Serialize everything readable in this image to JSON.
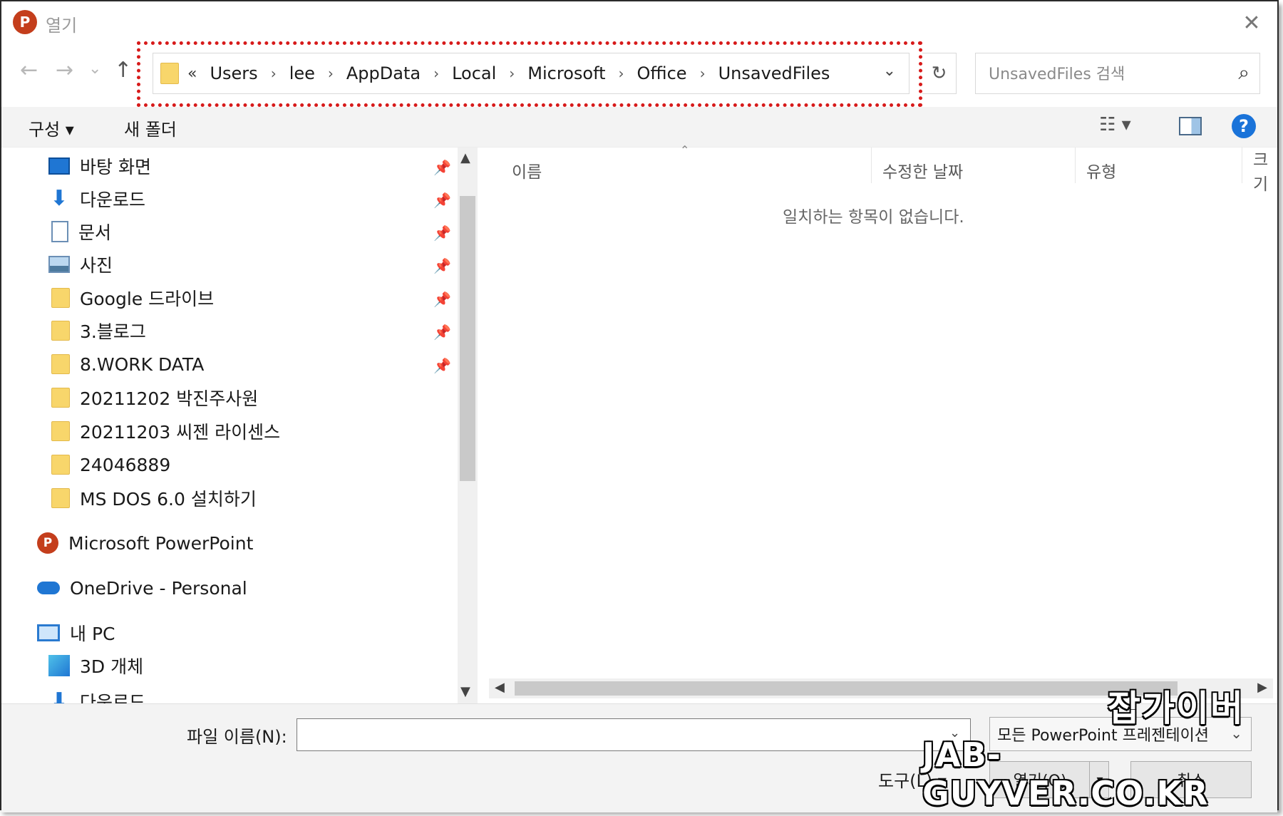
{
  "window": {
    "title": "열기",
    "app_icon_letter": "P",
    "close_glyph": "✕"
  },
  "nav": {
    "back_glyph": "←",
    "forward_glyph": "→",
    "recent_glyph": "⌄",
    "up_glyph": "↑",
    "refresh_glyph": "↻"
  },
  "address": {
    "overflow": "«",
    "crumbs": [
      "Users",
      "lee",
      "AppData",
      "Local",
      "Microsoft",
      "Office",
      "UnsavedFiles"
    ],
    "separator": "›",
    "dropdown_glyph": "⌄"
  },
  "search": {
    "placeholder": "UnsavedFiles 검색",
    "icon_glyph": "⌕"
  },
  "toolbar": {
    "organize": "구성 ▾",
    "new_folder": "새 폴더",
    "view_glyph": "☷ ▾",
    "help": "?"
  },
  "sidebar": {
    "pin_glyph": "📌",
    "quick": [
      {
        "label": "바탕 화면",
        "icon": "desktop-icon"
      },
      {
        "label": "다운로드",
        "icon": "download-icon"
      },
      {
        "label": "문서",
        "icon": "document-icon"
      },
      {
        "label": "사진",
        "icon": "picture-icon"
      },
      {
        "label": "Google 드라이브",
        "icon": "folder-icon"
      },
      {
        "label": "3.블로그",
        "icon": "folder-icon"
      },
      {
        "label": "8.WORK DATA",
        "icon": "folder-icon"
      },
      {
        "label": "20211202 박진주사원",
        "icon": "folder-icon"
      },
      {
        "label": "20211203 씨젠 라이센스",
        "icon": "folder-icon"
      },
      {
        "label": "24046889",
        "icon": "folder-icon"
      },
      {
        "label": "MS DOS 6.0 설치하기",
        "icon": "folder-icon"
      }
    ],
    "powerpoint": "Microsoft PowerPoint",
    "onedrive": "OneDrive - Personal",
    "pc": "내 PC",
    "objects3d": "3D 개체",
    "downloads_cut": "다운로드"
  },
  "content": {
    "columns": [
      "이름",
      "수정한 날짜",
      "유형",
      "크기"
    ],
    "empty_message": "일치하는 항목이 없습니다."
  },
  "footer": {
    "filename_label": "파일 이름(N):",
    "filename_value": "",
    "filetype": "모든 PowerPoint 프레젠테이션",
    "tools": "도구(L) ▾",
    "open": "열기(O)",
    "cancel": "취소"
  },
  "watermark": {
    "line1": "잡가이버",
    "line2": "JAB-GUYVER.CO.KR"
  },
  "colors": {
    "highlight": "#d71a1a",
    "ppt": "#c43e1c",
    "accent": "#1a73d9",
    "folder": "#f8d66b"
  }
}
